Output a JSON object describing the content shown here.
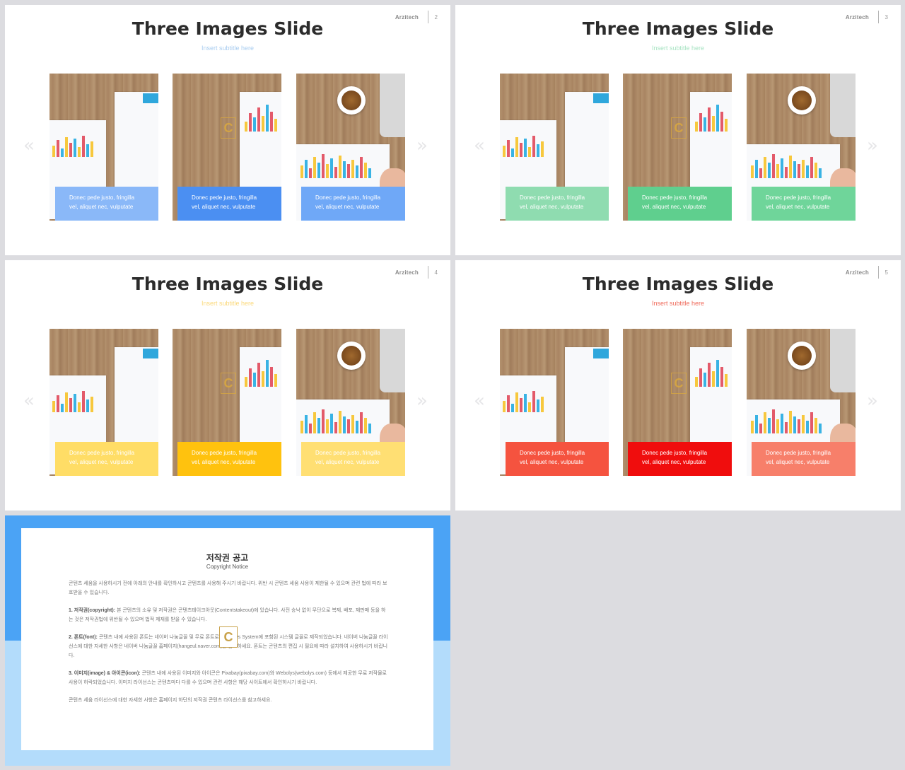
{
  "brand": "Arzitech",
  "slide_title": "Three Images Slide",
  "subtitle": "Insert  subtitle  here",
  "caption_line1": "Donec pede justo, fringilla",
  "caption_line2": "vel, aliquet nec, vulputate",
  "arrow_left": "«",
  "arrow_right": "»",
  "logo_letter": "C",
  "slides": [
    {
      "page": "2",
      "subtitle_color": "#a9cdf0",
      "caption_colors": [
        "#8ab8f8",
        "#4b8ff2",
        "#6fa8f7"
      ]
    },
    {
      "page": "3",
      "subtitle_color": "#a7e3c2",
      "caption_colors": [
        "#8fdcb0",
        "#5fcf8e",
        "#6fd59a"
      ]
    },
    {
      "page": "4",
      "subtitle_color": "#fbd97a",
      "caption_colors": [
        "#ffdd66",
        "#ffc20e",
        "#ffdf73"
      ]
    },
    {
      "page": "5",
      "subtitle_color": "#ef6a5a",
      "caption_colors": [
        "#f5533f",
        "#f00d0d",
        "#f77f6a"
      ]
    }
  ],
  "copyright": {
    "title": "저작권 공고",
    "subtitle": "Copyright Notice",
    "intro": "콘텐츠 세움을 사용하시기 전에 아래의 안내를 확인하시고 콘텐츠를 사용해 주시기 바랍니다. 위반 시 콘텐츠 세움 사용이 제한될 수 있으며 관련 법에 따라 보호받을 수 있습니다.",
    "sections": [
      {
        "heading": "1. 저작권(copyright):",
        "text": "본 콘텐츠의 소유 및 저작권은 콘텐츠테이크아웃(Contentstakeout)에 있습니다. 사전 승낙 없이 무단으로 복제, 배포, 재판매 등을 하는 것은 저작권법에 위반될 수 있으며 법적 제재를 받을 수 있습니다."
      },
      {
        "heading": "2. 폰트(font):",
        "text": "콘텐츠 내에 사용된 폰트는 네이버 나눔글꼴 및 무료 폰트로 Windows System에 포함된 시스템 글꼴로 제작되었습니다. 네이버 나눔글꼴 라이선스에 대한 자세한 사항은 네이버 나눔글꼴 홈페이지(hangeul.naver.com)를 참고하세요. 폰트는 콘텐츠의 편집 시 필요에 따라 설치하여 사용하시기 바랍니다."
      },
      {
        "heading": "3. 이미지(image) & 아이콘(icon):",
        "text": "콘텐츠 내에 사용된 이미지와 아이콘은 Pixabay(pixabay.com)와 Webolys(webolys.com) 등에서 제공한 무료 저작물로 사용이 허락되었습니다. 이미지 라이선스는 콘텐츠마다 다를 수 있으며 관련 사항은 해당 사이트에서 확인하시기 바랍니다."
      }
    ],
    "footer": "콘텐츠 세움 라이선스에 대한 자세한 사항은 홈페이지 하단의 저작권 콘텐츠 라이선스를 참고하세요."
  }
}
